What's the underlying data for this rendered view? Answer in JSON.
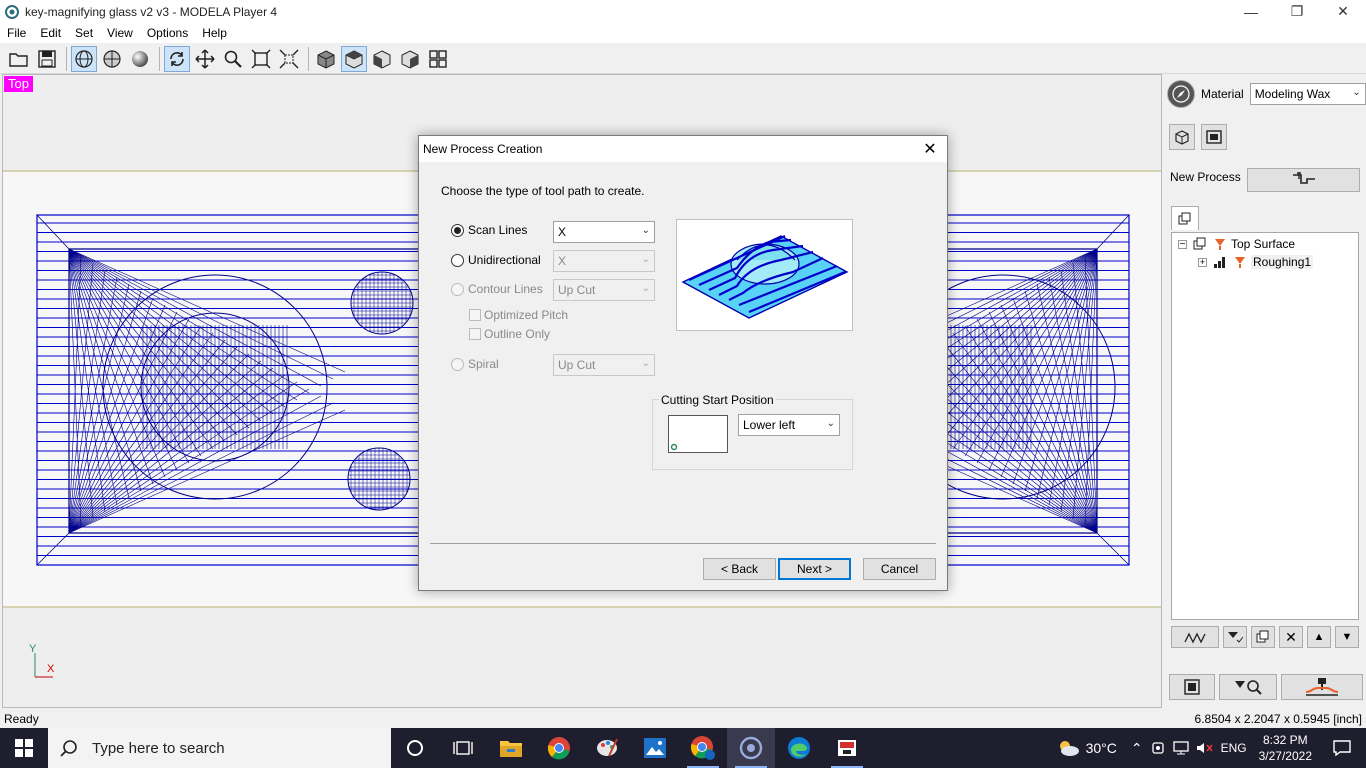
{
  "window": {
    "title": "key-magnifying glass v2 v3 - MODELA Player 4",
    "app_icon": "modela-player-icon",
    "controls": [
      "minimize-icon",
      "restore-icon",
      "close-icon"
    ]
  },
  "menu": [
    "File",
    "Edit",
    "Set",
    "View",
    "Options",
    "Help"
  ],
  "toolbar": {
    "buttons": [
      "open-folder-icon",
      "save-icon",
      "wireframe-icon",
      "shaded-wire-icon",
      "render-sphere-icon",
      "rotate-icon",
      "pan-icon",
      "zoom-icon",
      "fit-all-icon",
      "zoom-box-icon",
      "view-iso-icon",
      "view-top-icon",
      "view-front-icon",
      "view-right-icon",
      "view-multi-icon"
    ],
    "active": [
      "rotate-icon",
      "view-top-icon"
    ]
  },
  "viewport": {
    "label": "Top",
    "axis_y": "Y",
    "axis_x": "X"
  },
  "right_panel": {
    "material_label": "Material",
    "material_value": "Modeling Wax",
    "new_process_label": "New Process",
    "tree": {
      "root": "Top Surface",
      "child": "Roughing1"
    }
  },
  "dialog": {
    "title": "New Process Creation",
    "prompt": "Choose the type of tool path to create.",
    "options": {
      "scan_lines": {
        "label": "Scan Lines",
        "value": "X",
        "checked": true,
        "enabled": true
      },
      "unidirectional": {
        "label": "Unidirectional",
        "value": "X",
        "checked": false,
        "enabled": true
      },
      "contour_lines": {
        "label": "Contour Lines",
        "value": "Up Cut",
        "enabled": false
      },
      "optimized_pitch": {
        "label": "Optimized Pitch",
        "enabled": false
      },
      "outline_only": {
        "label": "Outline Only",
        "enabled": false
      },
      "spiral": {
        "label": "Spiral",
        "value": "Up Cut",
        "enabled": false
      }
    },
    "cutting_start": {
      "legend": "Cutting Start Position",
      "value": "Lower left"
    },
    "buttons": {
      "back": "< Back",
      "next": "Next >",
      "cancel": "Cancel"
    }
  },
  "status": {
    "left": "Ready",
    "right": "6.8504 x 2.2047 x 0.5945 [inch]"
  },
  "taskbar": {
    "search_placeholder": "Type here to search",
    "weather": "30°C",
    "language": "ENG",
    "time": "8:32 PM",
    "date": "3/27/2022"
  },
  "colors": {
    "mesh": "#00008b",
    "scan_line": "#0000cd",
    "view_label_bg": "#ff00ff",
    "accent": "#0078d7"
  }
}
